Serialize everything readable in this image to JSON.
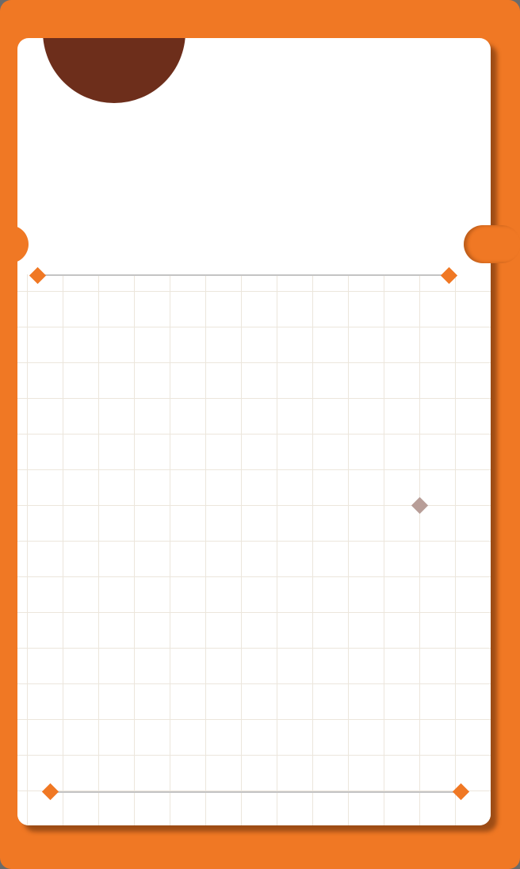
{
  "colors": {
    "frame": "#f07824",
    "card": "#ffffff",
    "header_circle": "#6d2e1b",
    "grid_line": "#ece6dc",
    "rule": "#c4c4c4",
    "marker": "#f07824",
    "marker_muted": "#b89e98"
  },
  "icons": {
    "corner_marker": "diamond-icon",
    "center_marker": "diamond-icon"
  }
}
